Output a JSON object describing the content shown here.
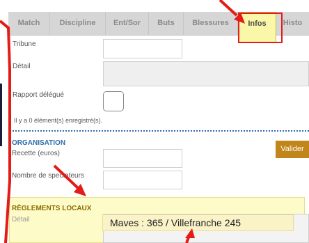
{
  "tabs": [
    {
      "label": "Match"
    },
    {
      "label": "Discipline"
    },
    {
      "label": "Ent/Sor"
    },
    {
      "label": "Buts"
    },
    {
      "label": "Blessures"
    },
    {
      "label": "Infos",
      "active": true
    },
    {
      "label": "Histo"
    }
  ],
  "form": {
    "tribune_label": "Tribune",
    "detail_label": "Détail",
    "rapport_label": "Rapport délégué",
    "records_text": "Il y a 0 élément(s) enregistré(s)."
  },
  "organisation": {
    "title": "ORGANISATION",
    "recette_label": "Recette (euros)",
    "spectateurs_label": "Nombre de spectateurs",
    "validate_label": "Valider"
  },
  "reglements": {
    "title": "RÈGLEMENTS LOCAUX",
    "detail_label": "Détail",
    "note_text": "Maves : 365 / Villefranche 245"
  },
  "colors": {
    "accent_blue": "#2e6da8",
    "button_gold": "#c0861a",
    "highlight_yellow": "#fdfbc8",
    "arrow_red": "#e41b17"
  }
}
